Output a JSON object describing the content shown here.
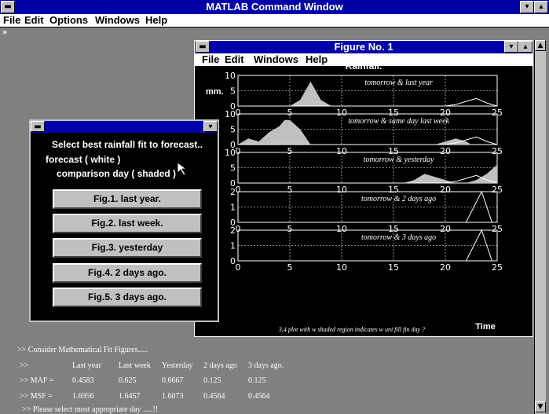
{
  "main_window": {
    "title": "MATLAB Command Window",
    "menu": [
      "File",
      "Edit",
      "Options",
      "Windows",
      "Help"
    ],
    "prompt": "»"
  },
  "figure_window": {
    "title": "Figure No. 1",
    "menu": [
      "File",
      "Edit",
      "Windows",
      "Help"
    ]
  },
  "dialog": {
    "lines": [
      "Select best rainfall fit to forecast..",
      "forecast ( white )",
      "comparison day ( shaded )"
    ],
    "buttons": [
      "Fig.1. last year.",
      "Fig.2. last week.",
      "Fig.3. yesterday",
      "Fig.4. 2 days ago.",
      "Fig.5. 3 days ago."
    ]
  },
  "console": {
    "intro": ">> Consider Mathematical Fit Figures.....",
    "header": [
      ">>",
      "Last year",
      "Last week",
      "Yesterday",
      "2 days ago",
      "3 days ago."
    ],
    "maf": [
      ">> MAF =",
      "0.4583",
      "0.625",
      "0.6667",
      "0.125",
      "0.125"
    ],
    "msf": [
      ">> MSF =",
      "1.6956",
      "1.6457",
      "1.6073",
      "0.4564",
      "0.4564"
    ],
    "footer": ">> Please select most appropriate day .....!!"
  },
  "chart_data": {
    "type": "area",
    "title": "Rainfall.",
    "ylabel": "mm.",
    "xlabel": "Time",
    "footnote": "3,4 plot with w shaded region indicates w uni fill fin day ?",
    "grid": true,
    "xlim": [
      0,
      25
    ],
    "xticks": [
      0,
      5,
      10,
      15,
      20,
      25
    ],
    "colors": {
      "forecast": "#ffffff",
      "comparison": "#c0c0c0",
      "background": "#000000"
    },
    "panels": [
      {
        "name": "tomorrow & last year",
        "ylim": [
          0,
          10
        ],
        "yticks": [
          0,
          5,
          10
        ],
        "comparison": [
          [
            0,
            0
          ],
          [
            5,
            0
          ],
          [
            6,
            2
          ],
          [
            7,
            8
          ],
          [
            8,
            2
          ],
          [
            9,
            0
          ],
          [
            25,
            0
          ]
        ],
        "forecast": [
          [
            0,
            0
          ],
          [
            20,
            0
          ],
          [
            21,
            0.5
          ],
          [
            22,
            1.5
          ],
          [
            23,
            2.5
          ],
          [
            24,
            1
          ],
          [
            25,
            0
          ]
        ]
      },
      {
        "name": "tomorrow & same day last week",
        "ylim": [
          0,
          10
        ],
        "yticks": [
          0,
          5,
          10
        ],
        "comparison": [
          [
            0,
            0
          ],
          [
            1,
            2
          ],
          [
            2,
            1
          ],
          [
            3,
            4
          ],
          [
            4,
            6
          ],
          [
            4.5,
            8
          ],
          [
            5,
            8
          ],
          [
            6,
            5
          ],
          [
            7,
            0
          ],
          [
            19,
            0
          ],
          [
            20,
            1
          ],
          [
            21,
            2
          ],
          [
            22,
            1
          ],
          [
            22.5,
            0
          ],
          [
            25,
            0
          ]
        ],
        "forecast": [
          [
            0,
            0
          ],
          [
            20,
            0
          ],
          [
            21,
            0.5
          ],
          [
            22,
            1.5
          ],
          [
            23,
            2.5
          ],
          [
            24,
            1
          ],
          [
            25,
            0
          ]
        ]
      },
      {
        "name": "tomorrow & yesterday",
        "ylim": [
          0,
          10
        ],
        "yticks": [
          0,
          5,
          10
        ],
        "comparison": [
          [
            0,
            0
          ],
          [
            16,
            0
          ],
          [
            17,
            1
          ],
          [
            18,
            3
          ],
          [
            19,
            2
          ],
          [
            20,
            1
          ],
          [
            21,
            0
          ],
          [
            22,
            0
          ],
          [
            23,
            1
          ],
          [
            24,
            3
          ],
          [
            25,
            6
          ]
        ],
        "forecast": [
          [
            0,
            0
          ],
          [
            20,
            0
          ],
          [
            21,
            0.5
          ],
          [
            22,
            1.5
          ],
          [
            23,
            2.5
          ],
          [
            24,
            1
          ],
          [
            25,
            0
          ]
        ]
      },
      {
        "name": "tomorrow & 2 days ago",
        "ylim": [
          0,
          2
        ],
        "yticks": [
          0,
          1,
          2
        ],
        "comparison": [
          [
            0,
            0
          ],
          [
            25,
            0
          ]
        ],
        "forecast": [
          [
            0,
            0
          ],
          [
            22,
            0
          ],
          [
            23.5,
            2
          ],
          [
            24.5,
            0
          ],
          [
            25,
            0
          ]
        ]
      },
      {
        "name": "tomorrow & 3 days ago",
        "ylim": [
          0,
          2
        ],
        "yticks": [
          0,
          1,
          2
        ],
        "comparison": [
          [
            0,
            0
          ],
          [
            25,
            0
          ]
        ],
        "forecast": [
          [
            0,
            0
          ],
          [
            22,
            0
          ],
          [
            23.5,
            2
          ],
          [
            24.5,
            0
          ],
          [
            25,
            0
          ]
        ]
      }
    ]
  }
}
